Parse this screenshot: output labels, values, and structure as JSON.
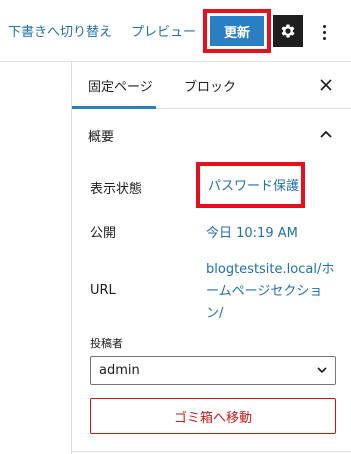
{
  "toolbar": {
    "switch_to_draft": "下書きへ切り替え",
    "preview": "プレビュー",
    "update": "更新",
    "settings_icon": "gear-icon",
    "options_icon": "more-vertical-icon"
  },
  "sidebar": {
    "tabs": [
      {
        "label": "固定ページ",
        "active": true
      },
      {
        "label": "ブロック",
        "active": false
      }
    ],
    "close_icon": "close-icon",
    "summary": {
      "title": "概要",
      "expanded": true,
      "visibility": {
        "label": "表示状態",
        "value": "パスワード保護"
      },
      "publish": {
        "label": "公開",
        "value": "今日 10:19 AM"
      },
      "url": {
        "label": "URL",
        "value_lines": [
          "blogtestsite.local/ホ",
          "ームページセクショ",
          "ン/"
        ]
      },
      "author": {
        "label": "投稿者",
        "value": "admin"
      },
      "trash": "ゴミ箱へ移動"
    }
  },
  "colors": {
    "accent": "#2a7fc4",
    "link": "#2271b1",
    "highlight_box": "#e8101d",
    "danger": "#cc1818"
  }
}
